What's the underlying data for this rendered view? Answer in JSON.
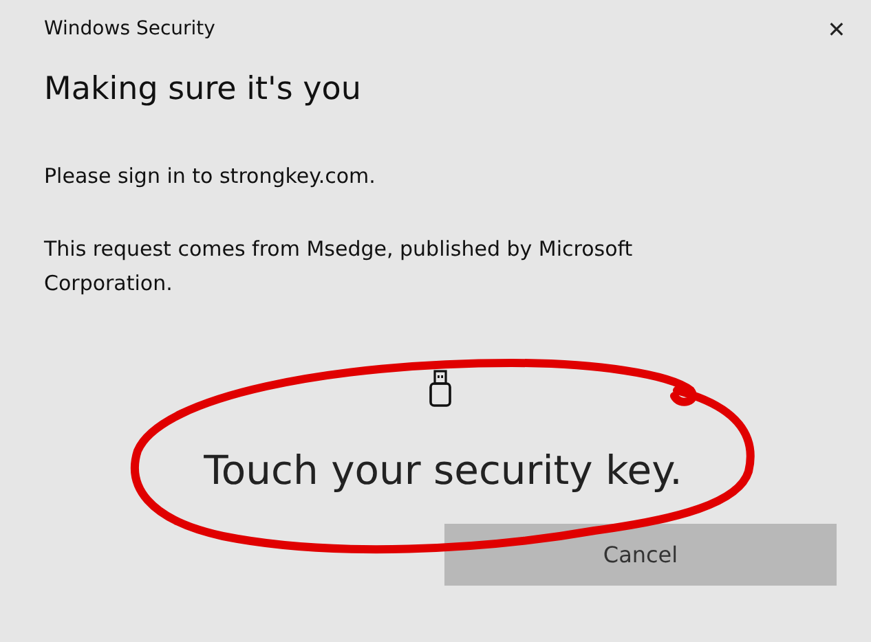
{
  "window": {
    "title": "Windows Security",
    "close": "✕"
  },
  "heading": "Making sure it's you",
  "messages": [
    "Please sign in to strongkey.com.",
    "This request comes from Msedge, published by Microsoft Corporation."
  ],
  "prompt": "Touch your security key.",
  "buttons": [
    {
      "label": "Cancel",
      "disabled": true
    }
  ]
}
